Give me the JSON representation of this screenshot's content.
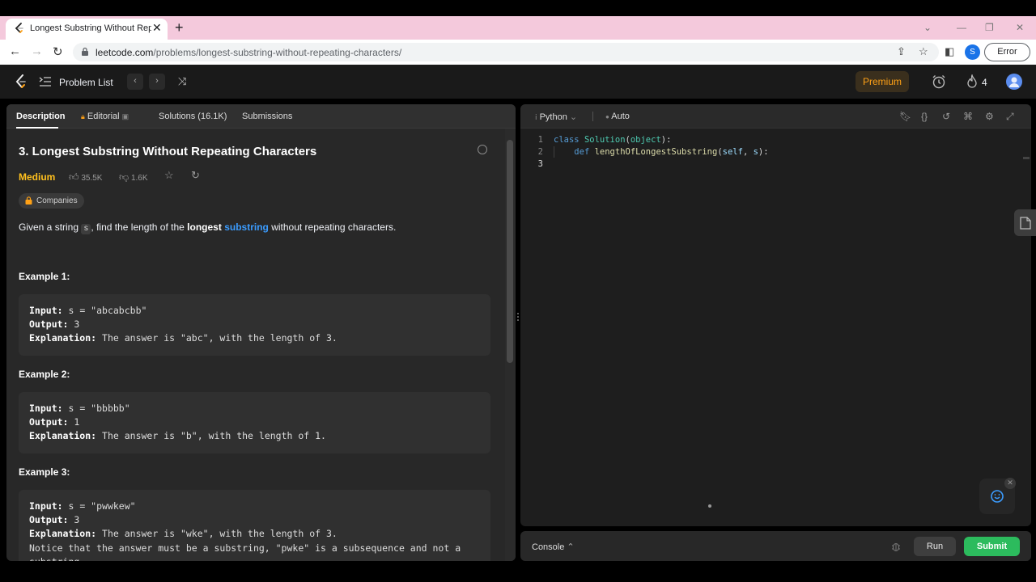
{
  "browser": {
    "tab_title": "Longest Substring Without Repe...",
    "new_tab": "+",
    "close_tab": "✕",
    "url_host": "leetcode.com",
    "url_path": "/problems/longest-substring-without-repeating-characters/",
    "profile_initial": "S",
    "error_label": "Error"
  },
  "header": {
    "problem_list": "Problem List",
    "premium": "Premium",
    "streak_count": "4",
    "brand_color": "#ffa116"
  },
  "left_tabs": {
    "description": "Description",
    "editorial": "Editorial",
    "solutions": "Solutions (16.1K)",
    "submissions": "Submissions"
  },
  "problem": {
    "title": "3. Longest Substring Without Repeating Characters",
    "difficulty": "Medium",
    "likes": "35.5K",
    "dislikes": "1.6K",
    "companies": "Companies",
    "statement": {
      "part1": "Given a string",
      "code": "s",
      "part2": ", find the length of the",
      "bold": "longest",
      "link": "substring",
      "part3": "without repeating characters."
    }
  },
  "examples": [
    {
      "label": "Example 1:",
      "input_label": "Input:",
      "input": "s = \"abcabcbb\"",
      "output_label": "Output:",
      "output": "3",
      "explanation_label": "Explanation:",
      "explanation": "The answer is \"abc\", with the length of 3."
    },
    {
      "label": "Example 2:",
      "input_label": "Input:",
      "input": "s = \"bbbbb\"",
      "output_label": "Output:",
      "output": "1",
      "explanation_label": "Explanation:",
      "explanation": "The answer is \"b\", with the length of 1."
    },
    {
      "label": "Example 3:",
      "input_label": "Input:",
      "input": "s = \"pwwkew\"",
      "output_label": "Output:",
      "output": "3",
      "explanation_label": "Explanation:",
      "explanation": "The answer is \"wke\", with the length of 3.",
      "note": "Notice that the answer must be a substring, \"pwke\" is a subsequence and not a substring."
    }
  ],
  "editor": {
    "language": "Python",
    "mode": "Auto",
    "line_numbers": [
      "1",
      "2",
      "3"
    ],
    "code": {
      "l1_kw": "class",
      "l1_cls": "Solution",
      "l1_base": "object",
      "l2_kw": "def",
      "l2_fn": "lengthOfLongestSubstring",
      "l2_p1": "self",
      "l2_p2": "s"
    }
  },
  "console": {
    "label": "Console",
    "run": "Run",
    "submit": "Submit",
    "submit_color": "#2cbb5d"
  }
}
